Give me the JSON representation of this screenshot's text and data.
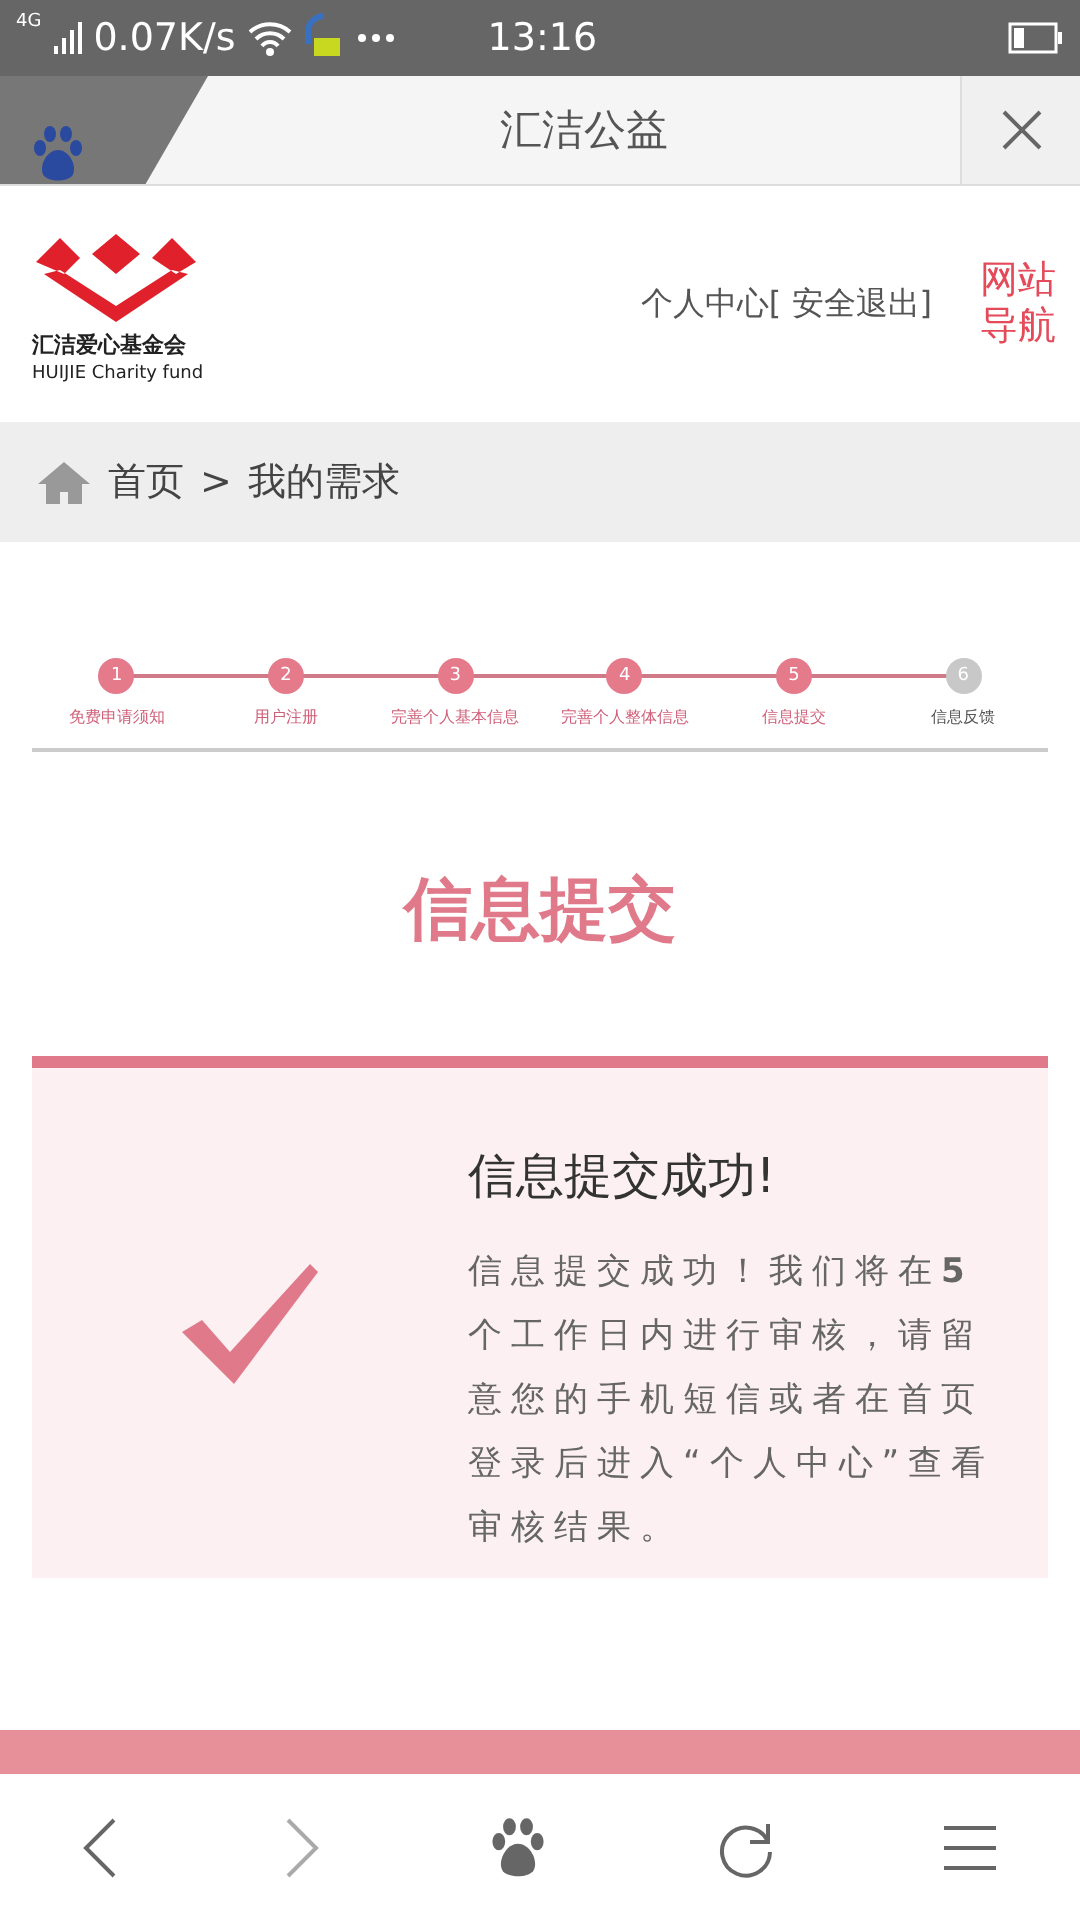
{
  "status_bar": {
    "network": "4G",
    "speed": "0.07K/s",
    "time": "13:16"
  },
  "browser": {
    "title": "汇洁公益"
  },
  "header": {
    "logo_name": "汇洁爱心基金会",
    "logo_english": "HUIJIE Charity fund",
    "user_links": "个人中心[ 安全退出]",
    "nav_lines": [
      "网站",
      "导航"
    ]
  },
  "breadcrumb": {
    "home": "首页",
    "separator": ">",
    "current": "我的需求"
  },
  "steps": [
    {
      "number": "1",
      "label": "免费申请须知",
      "done": true
    },
    {
      "number": "2",
      "label": "用户注册",
      "done": true
    },
    {
      "number": "3",
      "label": "完善个人基本信息",
      "done": true
    },
    {
      "number": "4",
      "label": "完善个人整体信息",
      "done": true
    },
    {
      "number": "5",
      "label": "信息提交",
      "done": true
    },
    {
      "number": "6",
      "label": "信息反馈",
      "done": false
    }
  ],
  "page_title": "信息提交",
  "result": {
    "heading": "信息提交成功!",
    "message": "信息提交成功！我们将在**5**个工作日内进行审核，请留意您的手机短信或者在首页登录后进入“个人中心”查看审核结果。"
  }
}
